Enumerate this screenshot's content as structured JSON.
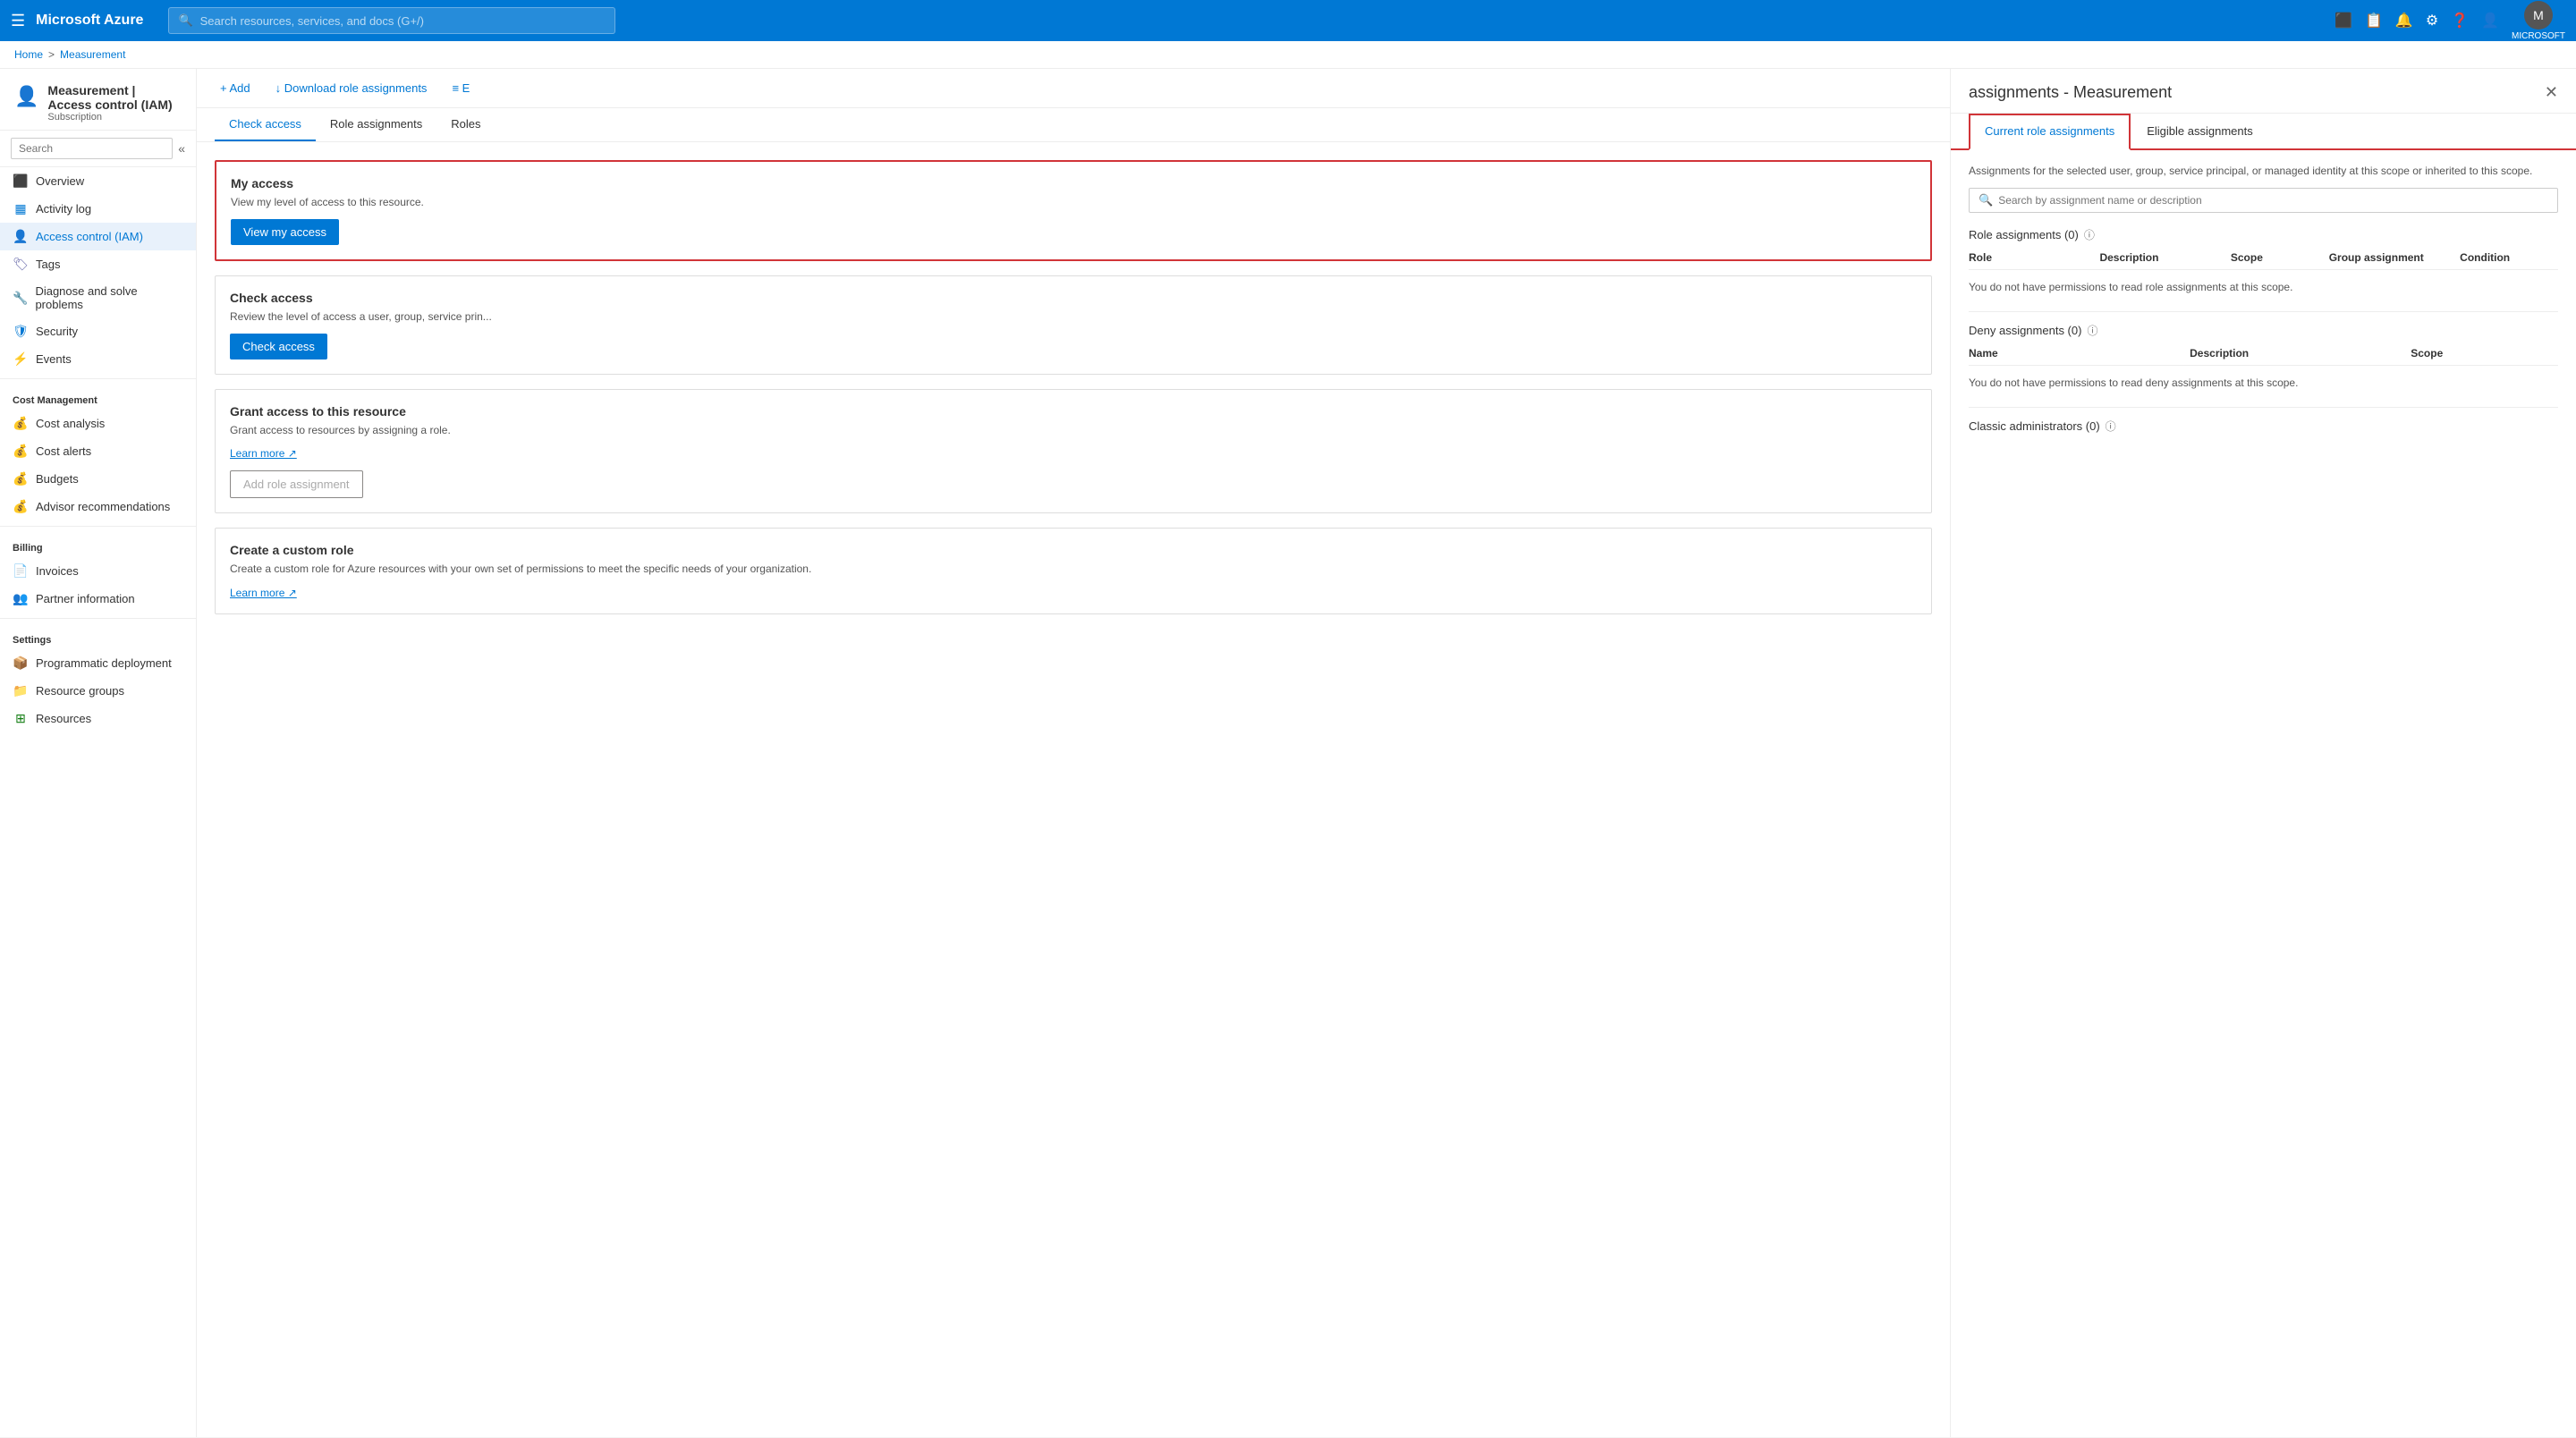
{
  "topbar": {
    "hamburger": "☰",
    "logo": "Microsoft Azure",
    "search_placeholder": "Search resources, services, and docs (G+/)",
    "user_label": "MICROSOFT",
    "icons": [
      "📺",
      "📋",
      "🔔",
      "⚙",
      "❓",
      "👤"
    ]
  },
  "breadcrumb": {
    "home": "Home",
    "separator1": ">",
    "current": "Measurement"
  },
  "sidebar": {
    "header_title": "Measurement | Access control (IAM)",
    "header_subtitle": "Subscription",
    "search_placeholder": "Search",
    "items": [
      {
        "id": "overview",
        "label": "Overview",
        "icon": "⬛",
        "color": "#f5a623"
      },
      {
        "id": "activity-log",
        "label": "Activity log",
        "icon": "▦",
        "color": "#0078d4"
      },
      {
        "id": "iam",
        "label": "Access control (IAM)",
        "icon": "👤",
        "color": "#6264a7",
        "active": true
      },
      {
        "id": "tags",
        "label": "Tags",
        "icon": "🏷",
        "color": "#6264a7"
      },
      {
        "id": "diagnose",
        "label": "Diagnose and solve problems",
        "icon": "🔧",
        "color": "#666"
      },
      {
        "id": "security",
        "label": "Security",
        "icon": "🛡",
        "color": "#0078d4"
      },
      {
        "id": "events",
        "label": "Events",
        "icon": "⚡",
        "color": "#f5a623"
      }
    ],
    "sections": [
      {
        "label": "Cost Management",
        "items": [
          {
            "id": "cost-analysis",
            "label": "Cost analysis",
            "icon": "💰",
            "color": "#107c10"
          },
          {
            "id": "cost-alerts",
            "label": "Cost alerts",
            "icon": "💰",
            "color": "#107c10"
          },
          {
            "id": "budgets",
            "label": "Budgets",
            "icon": "💰",
            "color": "#107c10"
          },
          {
            "id": "advisor",
            "label": "Advisor recommendations",
            "icon": "💰",
            "color": "#107c10"
          }
        ]
      },
      {
        "label": "Billing",
        "items": [
          {
            "id": "invoices",
            "label": "Invoices",
            "icon": "📄",
            "color": "#0078d4"
          },
          {
            "id": "partner",
            "label": "Partner information",
            "icon": "👥",
            "color": "#666"
          }
        ]
      },
      {
        "label": "Settings",
        "items": [
          {
            "id": "programmatic",
            "label": "Programmatic deployment",
            "icon": "📦",
            "color": "#0078d4"
          },
          {
            "id": "resource-groups",
            "label": "Resource groups",
            "icon": "📁",
            "color": "#0078d4"
          },
          {
            "id": "resources",
            "label": "Resources",
            "icon": "⊞",
            "color": "#107c10"
          }
        ]
      }
    ]
  },
  "main": {
    "toolbar": {
      "add_label": "+ Add",
      "download_label": "↓ Download role assignments",
      "more_label": "≡ E"
    },
    "tabs": [
      {
        "id": "check-access",
        "label": "Check access",
        "active": true
      },
      {
        "id": "role-assignments",
        "label": "Role assignments"
      },
      {
        "id": "roles",
        "label": "Roles"
      }
    ],
    "my_access_card": {
      "title": "My access",
      "description": "View my level of access to this resource.",
      "button_label": "View my access"
    },
    "check_access_card": {
      "title": "Check access",
      "description": "Review the level of access a user, group, service prin..."
    },
    "check_access_button": "Check access",
    "grant_access_card": {
      "title": "Grant access to this resource",
      "description": "Grant access to resources by assigning a role.",
      "learn_more": "Learn more ↗",
      "button_label": "Add role assignment"
    },
    "custom_role_card": {
      "title": "Create a custom role",
      "description": "Create a custom role for Azure resources with your own set of permissions to meet the specific needs of your organization.",
      "learn_more": "Learn more ↗"
    }
  },
  "side_panel": {
    "title": "assignments - Measurement",
    "close_icon": "✕",
    "tabs": [
      {
        "id": "current",
        "label": "Current role assignments",
        "active": true
      },
      {
        "id": "eligible",
        "label": "Eligible assignments"
      }
    ],
    "description": "Assignments for the selected user, group, service principal, or managed identity at this scope or inherited to this scope.",
    "search_placeholder": "Search by assignment name or description",
    "role_assignments": {
      "title": "Role assignments (0)",
      "columns": [
        "Role",
        "Description",
        "Scope",
        "Group assignment",
        "Condition"
      ],
      "no_permission_text": "You do not have permissions to read role assignments at this scope."
    },
    "deny_assignments": {
      "title": "Deny assignments (0)",
      "columns": [
        "Name",
        "Description",
        "Scope"
      ],
      "no_permission_text": "You do not have permissions to read deny assignments at this scope."
    },
    "classic_admins": {
      "title": "Classic administrators (0)"
    }
  }
}
